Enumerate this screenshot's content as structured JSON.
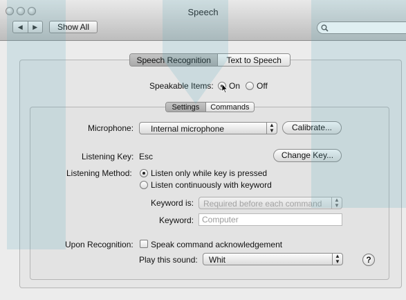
{
  "window": {
    "title": "Speech"
  },
  "toolbar": {
    "back_glyph": "◀",
    "forward_glyph": "▶",
    "show_all_label": "Show All",
    "search_placeholder": ""
  },
  "main_tabs": [
    {
      "label": "Speech Recognition",
      "selected": true
    },
    {
      "label": "Text to Speech",
      "selected": false
    }
  ],
  "speakable_items": {
    "label": "Speakable Items:",
    "on_label": "On",
    "off_label": "Off",
    "selected": "On"
  },
  "sub_tabs": [
    {
      "label": "Settings",
      "selected": true
    },
    {
      "label": "Commands",
      "selected": false
    }
  ],
  "microphone": {
    "label": "Microphone:",
    "value": "Internal microphone",
    "calibrate_label": "Calibrate..."
  },
  "listening_key": {
    "label": "Listening Key:",
    "value": "Esc",
    "change_key_label": "Change Key..."
  },
  "listening_method": {
    "label": "Listening Method:",
    "options": [
      "Listen only while key is pressed",
      "Listen continuously with keyword"
    ],
    "selected_index": 0
  },
  "keyword_is": {
    "label": "Keyword is:",
    "value": "Required before each command"
  },
  "keyword": {
    "label": "Keyword:",
    "placeholder": "Computer"
  },
  "upon_recognition": {
    "label": "Upon Recognition:",
    "checkbox_label": "Speak command acknowledgement",
    "checked": false
  },
  "play_sound": {
    "label": "Play this sound:",
    "value": "Whit"
  },
  "help_label": "?",
  "icons": [
    "search-icon",
    "popup-arrows-icon",
    "help-icon",
    "cursor-icon"
  ]
}
